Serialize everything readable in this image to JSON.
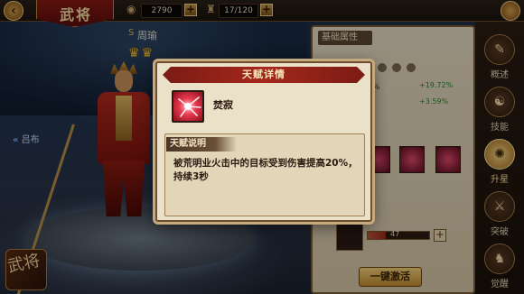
{
  "header": {
    "title": "武将",
    "coins": "2790",
    "stamina": "17/120",
    "coin_icon": "coin-icon",
    "stamina_icon": "stamina-icon"
  },
  "hero": {
    "name": "周瑜",
    "name_prefix": "S",
    "stars": "♛♛",
    "prev_hero": "吕布",
    "corner_label": "武将"
  },
  "panel": {
    "section_title": "基础属性",
    "stat_1_pct": "3%",
    "stat_1_bonus": "+19.72%",
    "stat_2_bonus": "+3.59%",
    "hp_value": "47",
    "activate_label": "一键激活"
  },
  "sidenav": {
    "items": [
      {
        "label": "概述",
        "icon": "overview-icon"
      },
      {
        "label": "技能",
        "icon": "skill-icon"
      },
      {
        "label": "升星",
        "icon": "star-up-icon"
      },
      {
        "label": "突破",
        "icon": "breakthrough-icon"
      },
      {
        "label": "觉醒",
        "icon": "awaken-icon"
      }
    ],
    "active_index": 2
  },
  "modal": {
    "title": "天赋详情",
    "talent_name": "焚寂",
    "talent_icon": "fire-burst-icon",
    "desc_heading": "天赋说明",
    "desc_text": "被荒明业火击中的目标受到伤害提高20%，持续3秒"
  },
  "colors": {
    "accent_red": "#a5281c",
    "gold": "#e9b93c",
    "parchment": "#ebe0c8",
    "bonus_green": "#1f8a2a"
  }
}
